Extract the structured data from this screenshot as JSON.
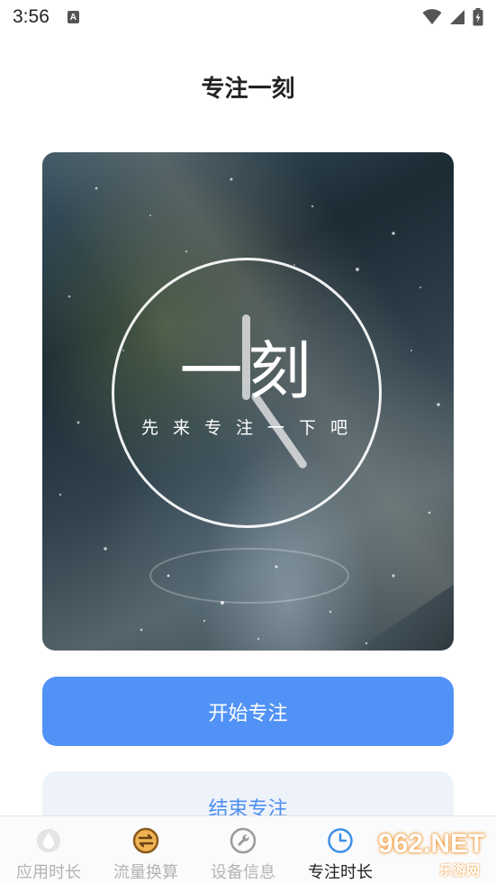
{
  "status_bar": {
    "time": "3:56",
    "notification_letter": "A",
    "icons": [
      "wifi-icon",
      "signal-icon",
      "battery-icon"
    ]
  },
  "header": {
    "title": "专注一刻"
  },
  "hero": {
    "title": "一刻",
    "subtitle": "先来专注一下吧",
    "image_description": "rain on pavement"
  },
  "actions": {
    "start_label": "开始专注",
    "end_label": "结束专注"
  },
  "tabs": [
    {
      "label": "应用时长",
      "icon": "drop-icon",
      "active": false
    },
    {
      "label": "流量换算",
      "icon": "exchange-icon",
      "active": false
    },
    {
      "label": "设备信息",
      "icon": "wrench-icon",
      "active": false
    },
    {
      "label": "专注时长",
      "icon": "clock-icon",
      "active": true
    }
  ],
  "watermark": {
    "logo_text": "962.NET",
    "sub_text": "乐游网"
  },
  "colors": {
    "primary": "#5192f6",
    "secondary_bg": "#eef3fa",
    "tab_active": "#3f8fe8",
    "tab_inactive": "#b3b3b3"
  }
}
